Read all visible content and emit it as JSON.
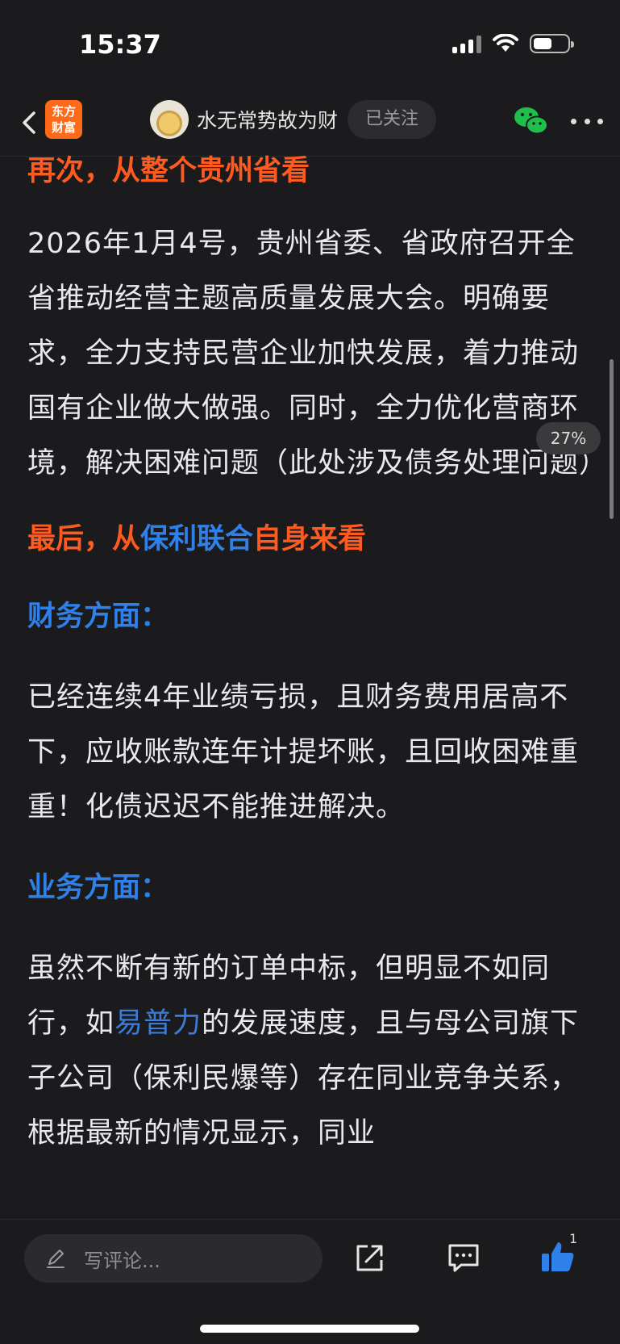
{
  "status_bar": {
    "time": "15:37"
  },
  "nav": {
    "app_logo": "东方\n财富",
    "author_name": "水无常势故为财",
    "follow_label": "已关注"
  },
  "article": {
    "heading_guizhou": "再次，从整个贵州省看",
    "para_guizhou": "2026年1月4号，贵州省委、省政府召开全省推动经营主题高质量发展大会。明确要求，全力支持民营企业加快发展，着力推动国有企业做大做强。同时，全力优化营商环境，解决困难问题（此处涉及债务处理问题）",
    "heading_poly_prefix": "最后，从",
    "heading_poly_link": "保利联合",
    "heading_poly_suffix": "自身来看",
    "finance_heading": "财务方面：",
    "finance_para": "已经连续4年业绩亏损，且财务费用居高不下，应收账款连年计提坏账，且回收困难重重！化债迟迟不能推进解决。",
    "business_heading": "业务方面：",
    "business_para_1": "虽然不断有新的订单中标，但明显不如同行，如",
    "business_para_link": "易普力",
    "business_para_2": "的发展速度，且与母公司旗下子公司（保利民爆等）存在同业竞争关系，根据最新的情况显示，同业"
  },
  "reading_progress": "27%",
  "bottom_bar": {
    "comment_placeholder": "写评论...",
    "like_count": "1"
  },
  "colors": {
    "background": "#1b1b1d",
    "heading_orange": "#ff5a1f",
    "heading_blue": "#2f80e8",
    "link_blue": "#3b7dd8",
    "brand_orange": "#ff6a1a",
    "wechat_green": "#1fbf4c",
    "like_blue": "#2f80e8"
  },
  "icons": [
    "back-chevron-icon",
    "wechat-icon",
    "more-icon",
    "pencil-icon",
    "share-icon",
    "comment-icon",
    "thumbs-up-icon",
    "wifi-icon",
    "signal-icon",
    "battery-icon"
  ]
}
